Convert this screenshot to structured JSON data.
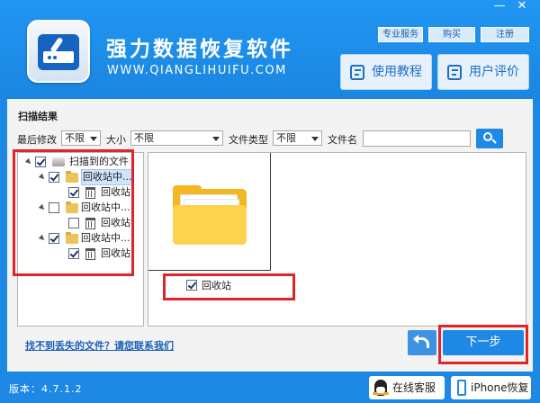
{
  "window": {
    "minimize_glyph": "—",
    "close_glyph": "✕"
  },
  "header": {
    "title": "强力数据恢复软件",
    "url": "WWW.QIANGLIHUIFU.COM",
    "top_links": [
      "专业服务",
      "购买",
      "注册"
    ],
    "buttons": [
      {
        "label": "使用教程",
        "icon": "book-icon"
      },
      {
        "label": "用户评价",
        "icon": "comment-icon"
      }
    ]
  },
  "scan": {
    "title": "扫描结果",
    "filters": {
      "modified_label": "最后修改",
      "modified_value": "不限",
      "size_label": "大小",
      "size_value": "不限",
      "type_label": "文件类型",
      "type_value": "不限",
      "name_label": "文件名",
      "name_value": ""
    }
  },
  "tree": {
    "root": {
      "label": "扫描到的文件",
      "checked": true
    },
    "groups": [
      {
        "label": "回收站中...",
        "checked": true,
        "child": {
          "label": "回收站",
          "checked": true
        },
        "selected": true
      },
      {
        "label": "回收站中...",
        "checked": false,
        "child": {
          "label": "回收站",
          "checked": false
        },
        "selected": false
      },
      {
        "label": "回收站中...",
        "checked": true,
        "child": {
          "label": "回收站",
          "checked": true
        },
        "selected": false
      }
    ]
  },
  "content": {
    "items": [
      {
        "label": "回收站",
        "checked": true,
        "icon": "folder-icon"
      }
    ]
  },
  "actions": {
    "help_link": "找不到丢失的文件？请您联系我们",
    "next_label": "下一步",
    "back_icon": "back-arrow-icon"
  },
  "footer": {
    "version": "版本：4.7.1.2",
    "online_service": "在线客服",
    "iphone_recovery": "iPhone恢复"
  },
  "colors": {
    "brand_blue": "#1e88e5",
    "highlight_red": "#e0242a",
    "folder_yellow": "#f3b821"
  }
}
